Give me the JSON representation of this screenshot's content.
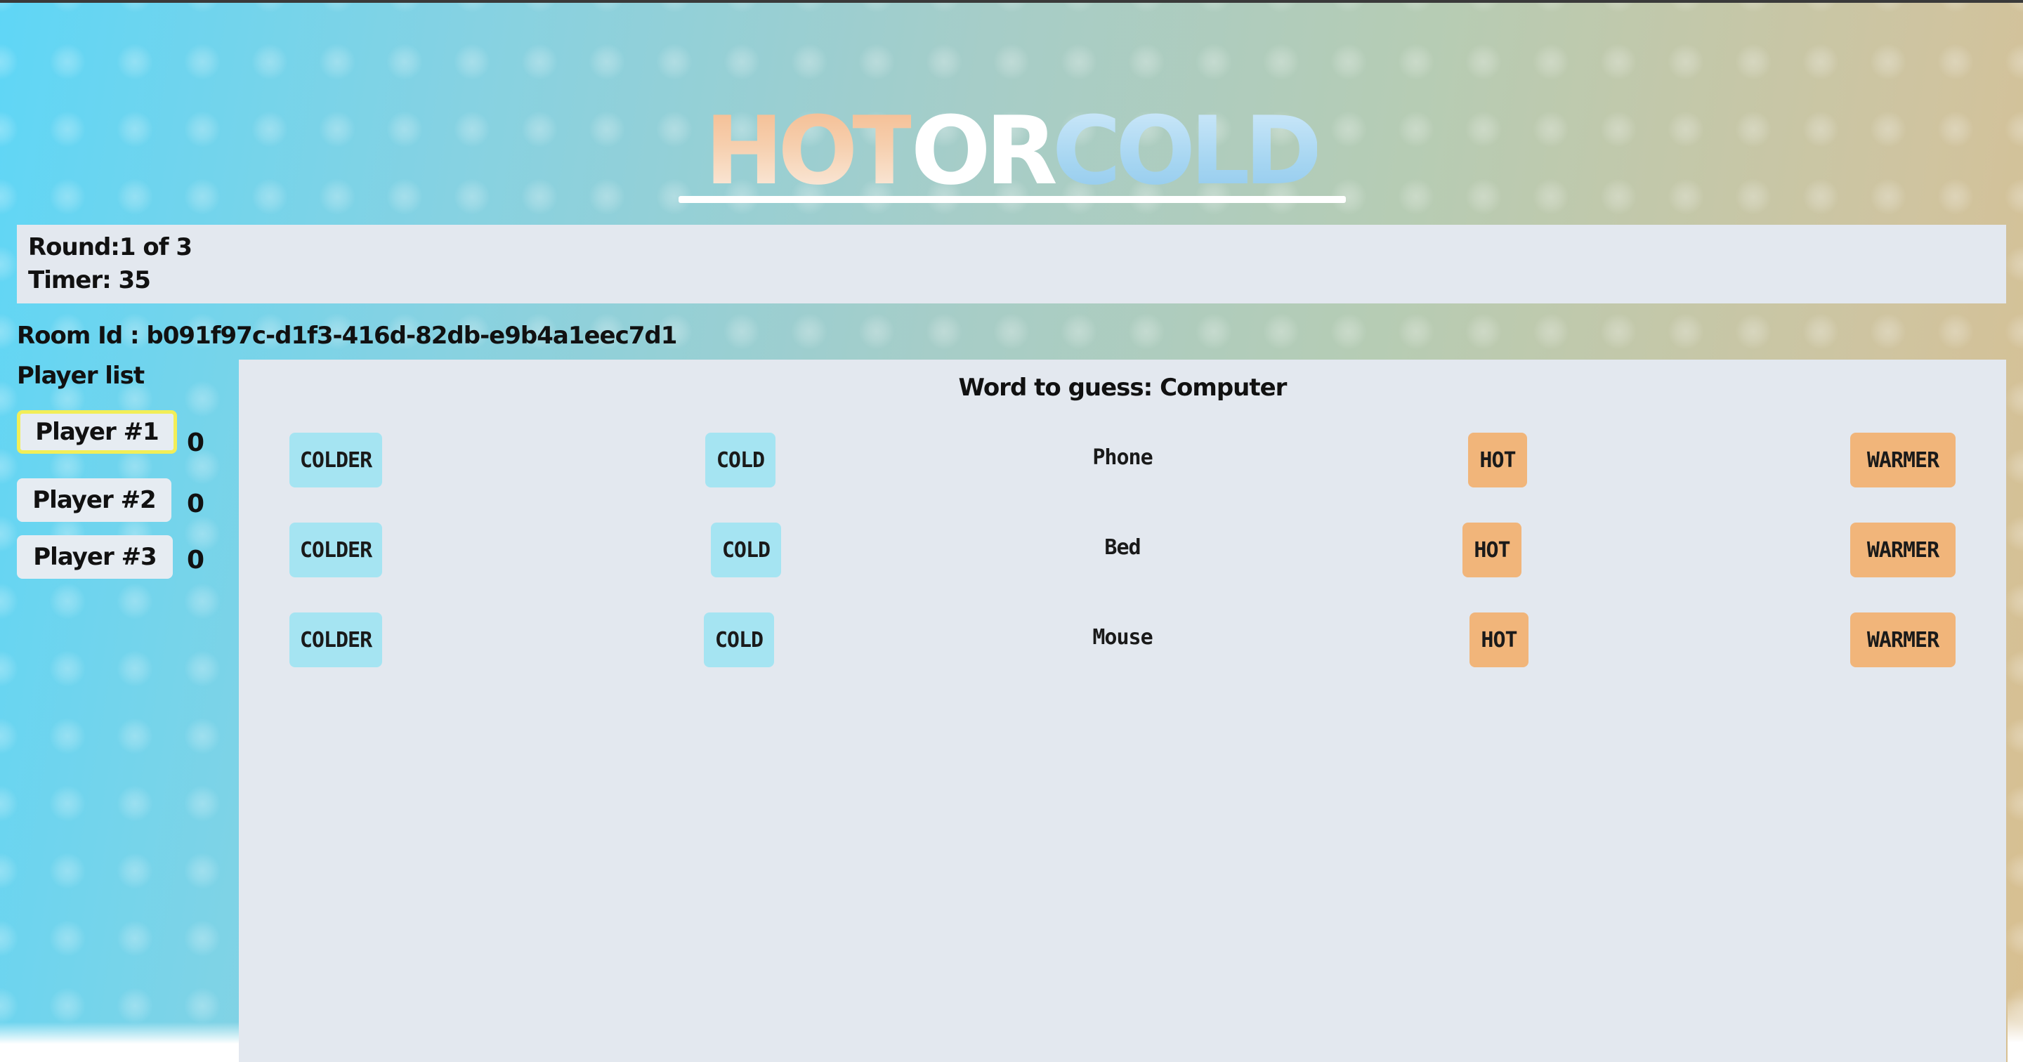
{
  "logo": {
    "part1": "HOT",
    "part2": "OR",
    "part3": "COLD"
  },
  "round": {
    "round_text": "Round:1 of 3",
    "timer_text": "Timer: 35"
  },
  "room": {
    "room_id_text": "Room Id : b091f97c-d1f3-416d-82db-e9b4a1eec7d1"
  },
  "players": {
    "title": "Player list",
    "items": [
      {
        "name": "Player #1",
        "score": "0",
        "active": true
      },
      {
        "name": "Player #2",
        "score": "0",
        "active": false
      },
      {
        "name": "Player #3",
        "score": "0",
        "active": false
      }
    ]
  },
  "game": {
    "word_to_guess_text": "Word to guess: Computer",
    "guesses": [
      {
        "colder": "COLDER",
        "cold": "COLD",
        "word": "Phone",
        "hot": "HOT",
        "warmer": "WARMER"
      },
      {
        "colder": "COLDER",
        "cold": "COLD",
        "word": "Bed",
        "hot": "HOT",
        "warmer": "WARMER"
      },
      {
        "colder": "COLDER",
        "cold": "COLD",
        "word": "Mouse",
        "hot": "HOT",
        "warmer": "WARMER"
      }
    ]
  },
  "colors": {
    "cold_button": "#a5e4f2",
    "hot_button": "#f1b57a",
    "active_player_border": "#f2ee57",
    "panel": "#e3e8ef"
  }
}
